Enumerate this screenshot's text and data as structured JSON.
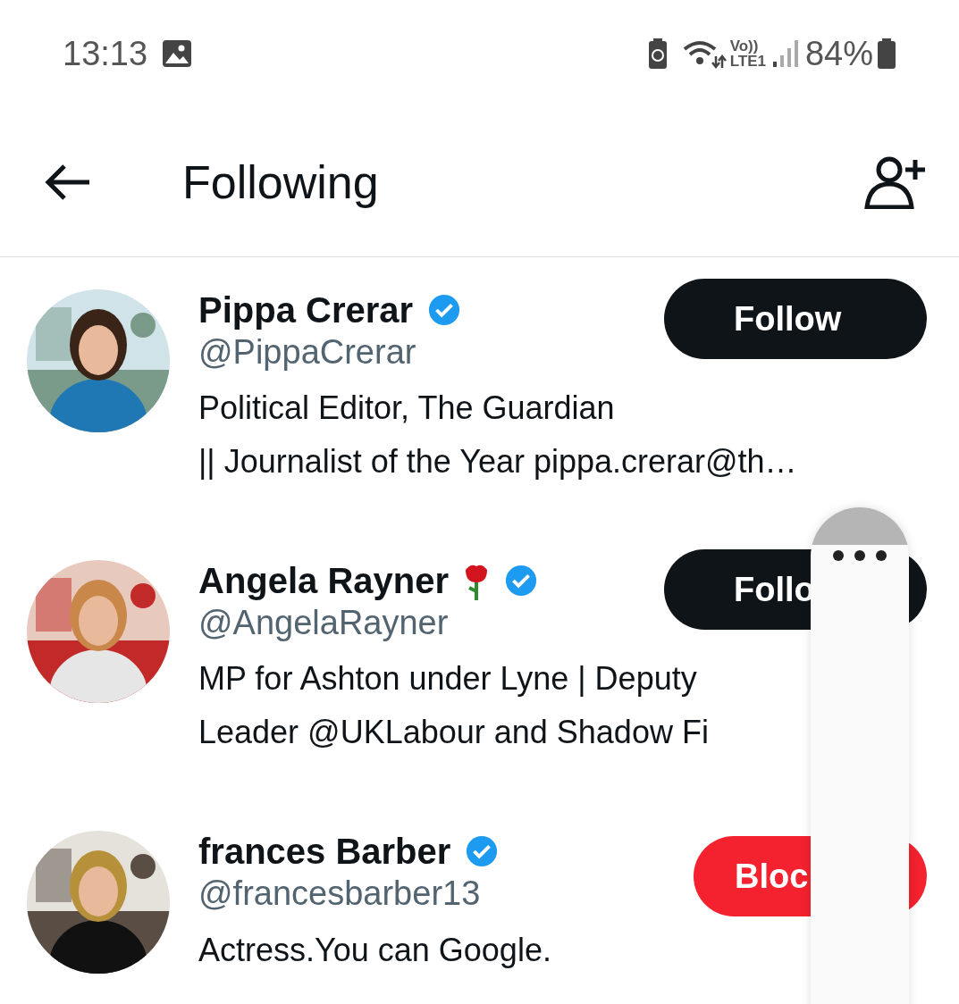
{
  "status_bar": {
    "time": "13:13",
    "network": "Vo))",
    "network_sub": "LTE1",
    "battery": "84%"
  },
  "header": {
    "title": "Following"
  },
  "users": [
    {
      "name": "Pippa Crerar",
      "verified": true,
      "emoji": false,
      "handle": "@PippaCrerar",
      "bio_lines": [
        "Political Editor, The Guardian",
        "|| Journalist of the Year pippa.crerar@th…"
      ],
      "button": {
        "label": "Follow",
        "kind": "follow"
      },
      "picture": {
        "kind": "picture"
      }
    },
    {
      "name": "Angela Rayner",
      "verified": true,
      "emoji": true,
      "handle": "@AngelaRayner",
      "bio_lines": [
        "MP for Ashton under Lyne | Deputy",
        "Leader @UKLabour and Shadow Fi"
      ],
      "button": {
        "label": "Follo",
        "kind": "follow"
      },
      "picture": {
        "kind": "picture"
      }
    },
    {
      "name": "frances Barber",
      "verified": true,
      "emoji": false,
      "handle": "@francesbarber13",
      "bio_lines": [
        "Actress.You can Google."
      ],
      "button": {
        "label": "Bloc",
        "kind": "blocked"
      },
      "picture": {
        "kind": "picture"
      }
    }
  ]
}
